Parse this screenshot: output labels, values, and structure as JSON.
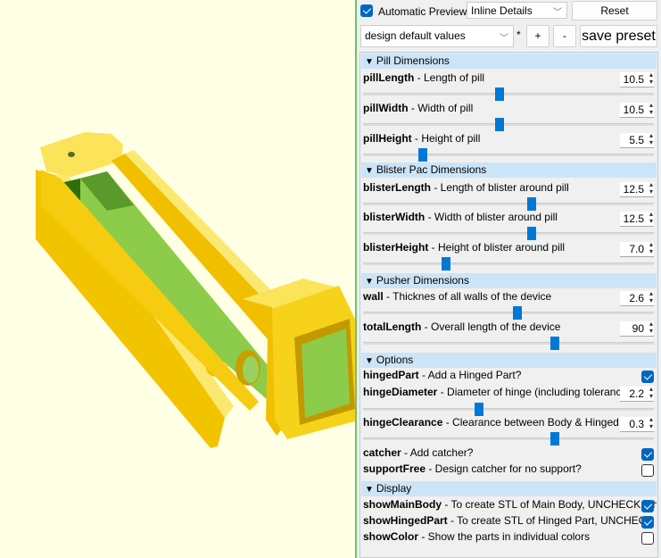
{
  "toolbar": {
    "auto_preview_label": "Automatic Preview",
    "auto_preview_checked": true,
    "view_mode": "Inline Details",
    "reset_label": "Reset"
  },
  "preset": {
    "selected": "design default values",
    "modified_marker": "*",
    "add_label": "+",
    "remove_label": "-",
    "save_label": "save preset"
  },
  "colors": {
    "accent": "#0078d7",
    "section_bg": "#cce4f7",
    "viewport_bg": "#ffffe5",
    "model_yellow": "#f9d71c",
    "model_green": "#8ccc4a"
  },
  "sections": [
    {
      "title": "Pill Dimensions",
      "params": [
        {
          "name": "pillLength",
          "desc": " - Length of pill",
          "value": "10.5",
          "slider_position": 0.47
        },
        {
          "name": "pillWidth",
          "desc": " - Width of pill",
          "value": "10.5",
          "slider_position": 0.47
        },
        {
          "name": "pillHeight",
          "desc": " - Height of pill",
          "value": "5.5",
          "slider_position": 0.205
        }
      ]
    },
    {
      "title": "Blister Pac Dimensions",
      "params": [
        {
          "name": "blisterLength",
          "desc": " - Length of blister around pill",
          "value": "12.5",
          "slider_position": 0.58
        },
        {
          "name": "blisterWidth",
          "desc": " - Width of blister around pill",
          "value": "12.5",
          "slider_position": 0.58
        },
        {
          "name": "blisterHeight",
          "desc": " - Height of blister around pill",
          "value": "7.0",
          "slider_position": 0.285
        }
      ]
    },
    {
      "title": "Pusher Dimensions",
      "params": [
        {
          "name": "wall",
          "desc": " - Thicknes of all walls of the device",
          "value": "2.6",
          "slider_position": 0.53
        },
        {
          "name": "totalLength",
          "desc": " - Overall length of the device",
          "value": "90",
          "slider_position": 0.66
        }
      ]
    },
    {
      "title": "Options",
      "params": [
        {
          "name": "hingedPart",
          "desc": " - Add a Hinged Part?",
          "checked": true
        },
        {
          "name": "hingeDiameter",
          "desc": " - Diameter of hinge (including tolerance)",
          "value": "2.2",
          "slider_position": 0.4
        },
        {
          "name": "hingeClearance",
          "desc": " - Clearance between Body & Hinged Par",
          "value": "0.3",
          "slider_position": 0.66
        },
        {
          "name": "catcher",
          "desc": " - Add catcher?",
          "checked": true
        },
        {
          "name": "supportFree",
          "desc": " - Design catcher for no support?",
          "checked": false
        }
      ]
    },
    {
      "title": "Display",
      "params": [
        {
          "name": "showMainBody",
          "desc": " - To create STL of Main Body, UNCHECK oth",
          "checked": true
        },
        {
          "name": "showHingedPart",
          "desc": " - To create STL of Hinged Part, UNCHECK",
          "checked": true
        },
        {
          "name": "showColor",
          "desc": " - Show the parts in individual colors",
          "checked": false
        }
      ]
    }
  ]
}
